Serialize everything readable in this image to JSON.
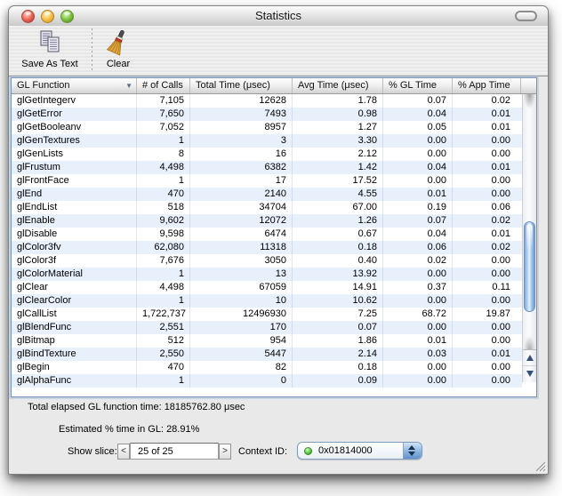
{
  "window": {
    "title": "Statistics"
  },
  "toolbar": {
    "save_label": "Save As Text",
    "clear_label": "Clear",
    "save_icon": "documents-icon",
    "clear_icon": "broom-icon"
  },
  "table": {
    "columns": [
      {
        "label": "GL Function"
      },
      {
        "label": "# of Calls"
      },
      {
        "label": "Total Time (μsec)"
      },
      {
        "label": "Avg Time (μsec)"
      },
      {
        "label": "% GL Time"
      },
      {
        "label": "% App Time"
      }
    ],
    "sort": {
      "column": 0,
      "direction": "desc",
      "indicator": "▼"
    },
    "rows": [
      [
        "glGetIntegerv",
        "7,105",
        "12628",
        "1.78",
        "0.07",
        "0.02"
      ],
      [
        "glGetError",
        "7,650",
        "7493",
        "0.98",
        "0.04",
        "0.01"
      ],
      [
        "glGetBooleanv",
        "7,052",
        "8957",
        "1.27",
        "0.05",
        "0.01"
      ],
      [
        "glGenTextures",
        "1",
        "3",
        "3.30",
        "0.00",
        "0.00"
      ],
      [
        "glGenLists",
        "8",
        "16",
        "2.12",
        "0.00",
        "0.00"
      ],
      [
        "glFrustum",
        "4,498",
        "6382",
        "1.42",
        "0.04",
        "0.01"
      ],
      [
        "glFrontFace",
        "1",
        "17",
        "17.52",
        "0.00",
        "0.00"
      ],
      [
        "glEnd",
        "470",
        "2140",
        "4.55",
        "0.01",
        "0.00"
      ],
      [
        "glEndList",
        "518",
        "34704",
        "67.00",
        "0.19",
        "0.06"
      ],
      [
        "glEnable",
        "9,602",
        "12072",
        "1.26",
        "0.07",
        "0.02"
      ],
      [
        "glDisable",
        "9,598",
        "6474",
        "0.67",
        "0.04",
        "0.01"
      ],
      [
        "glColor3fv",
        "62,080",
        "11318",
        "0.18",
        "0.06",
        "0.02"
      ],
      [
        "glColor3f",
        "7,676",
        "3050",
        "0.40",
        "0.02",
        "0.00"
      ],
      [
        "glColorMaterial",
        "1",
        "13",
        "13.92",
        "0.00",
        "0.00"
      ],
      [
        "glClear",
        "4,498",
        "67059",
        "14.91",
        "0.37",
        "0.11"
      ],
      [
        "glClearColor",
        "1",
        "10",
        "10.62",
        "0.00",
        "0.00"
      ],
      [
        "glCallList",
        "1,722,737",
        "12496930",
        "7.25",
        "68.72",
        "19.87"
      ],
      [
        "glBlendFunc",
        "2,551",
        "170",
        "0.07",
        "0.00",
        "0.00"
      ],
      [
        "glBitmap",
        "512",
        "954",
        "1.86",
        "0.01",
        "0.00"
      ],
      [
        "glBindTexture",
        "2,550",
        "5447",
        "2.14",
        "0.03",
        "0.01"
      ],
      [
        "glBegin",
        "470",
        "82",
        "0.18",
        "0.00",
        "0.00"
      ],
      [
        "glAlphaFunc",
        "1",
        "0",
        "0.09",
        "0.00",
        "0.00"
      ]
    ]
  },
  "footer": {
    "total_label": "Total elapsed GL function time:",
    "total_value": "18185762.80 μsec",
    "estimated_label": "Estimated % time in GL:",
    "estimated_value": "28.91%",
    "slice_label": "Show slice:",
    "slice_value": "25 of 25",
    "prev_glyph": "<",
    "next_glyph": ">",
    "context_label": "Context ID:",
    "context_value": "0x01814000"
  },
  "colors": {
    "row_alt": "#e8f1fb",
    "scroll_thumb": "#7fabdf",
    "table_border": "#7593b5",
    "status_led": "#62ce41"
  }
}
